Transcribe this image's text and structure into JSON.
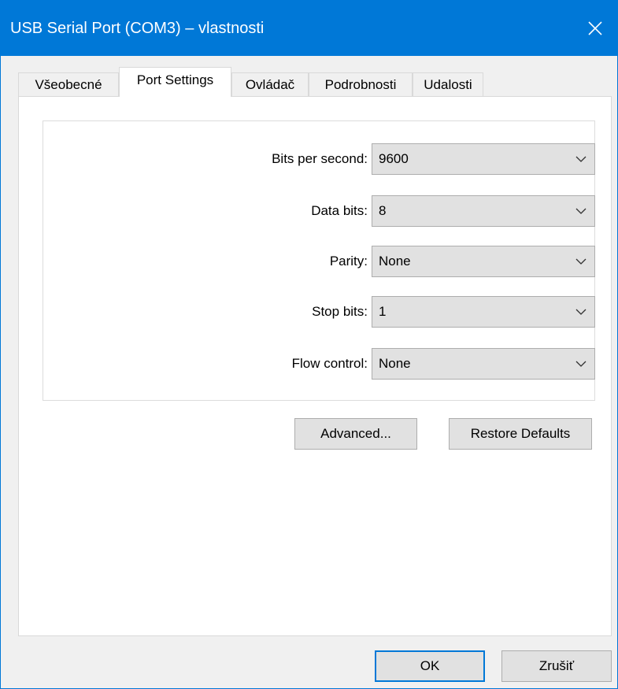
{
  "window": {
    "title": "USB Serial Port (COM3) – vlastnosti"
  },
  "tabs": [
    {
      "label": "Všeobecné",
      "active": false
    },
    {
      "label": "Port Settings",
      "active": true
    },
    {
      "label": "Ovládač",
      "active": false
    },
    {
      "label": "Podrobnosti",
      "active": false
    },
    {
      "label": "Udalosti",
      "active": false
    }
  ],
  "port_settings": {
    "fields": [
      {
        "label": "Bits per second:",
        "value": "9600"
      },
      {
        "label": "Data bits:",
        "value": "8"
      },
      {
        "label": "Parity:",
        "value": "None"
      },
      {
        "label": "Stop bits:",
        "value": "1"
      },
      {
        "label": "Flow control:",
        "value": "None"
      }
    ],
    "advanced_label": "Advanced...",
    "restore_label": "Restore Defaults"
  },
  "footer": {
    "ok_label": "OK",
    "cancel_label": "Zrušiť"
  },
  "colors": {
    "titlebar": "#0078d7",
    "dialog_background": "#f0f0f0",
    "panel_background": "#ffffff",
    "control_face": "#e1e1e1",
    "default_button_border": "#0078d7"
  }
}
